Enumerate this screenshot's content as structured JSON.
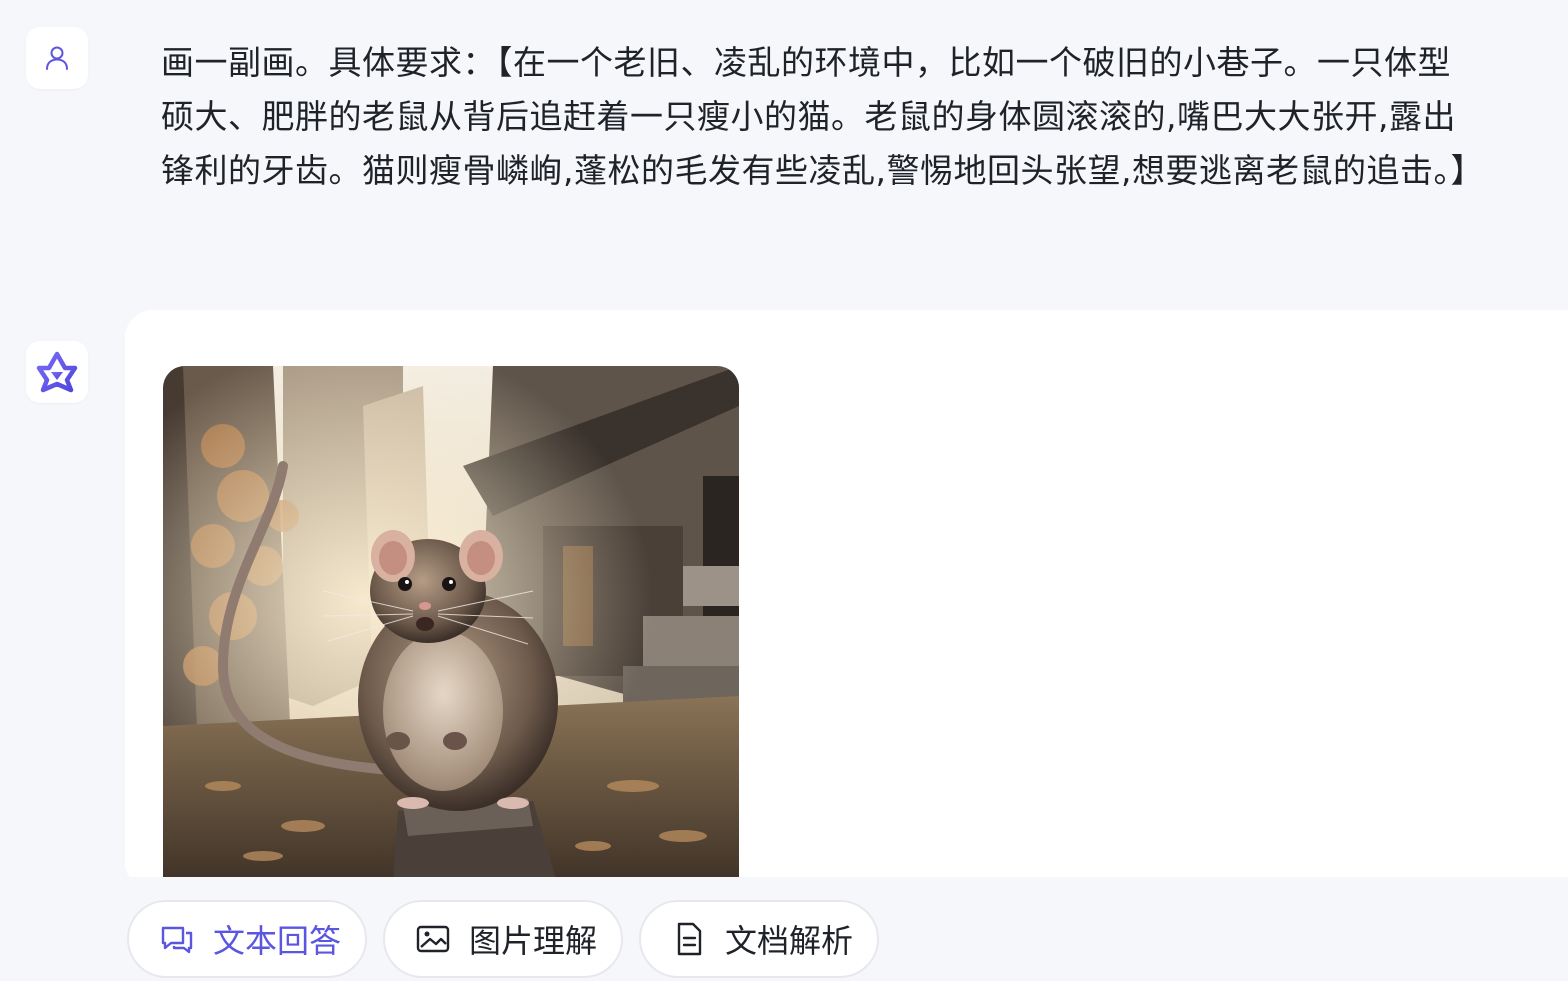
{
  "chat": {
    "user_message": "画一副画。具体要求：【在一个老旧、凌乱的环境中，比如一个破旧的小巷子。一只体型硕大、肥胖的老鼠从背后追赶着一只瘦小的猫。老鼠的身体圆滚滚的,嘴巴大大张开,露出锋利的牙齿。猫则瘦骨嶙峋,蓬松的毛发有些凌乱,警惕地回头张望,想要逃离老鼠的追击。】",
    "user_avatar_icon": "user-icon",
    "bot_avatar_icon": "assistant-logo-icon"
  },
  "bottom_bar": {
    "modes": [
      {
        "label": "文本回答",
        "icon": "chat-bubbles-icon",
        "active": true
      },
      {
        "label": "图片理解",
        "icon": "image-icon",
        "active": false
      },
      {
        "label": "文档解析",
        "icon": "document-icon",
        "active": false
      }
    ]
  },
  "colors": {
    "accent": "#5b56e0",
    "background": "#f6f7fb",
    "card": "#ffffff"
  }
}
